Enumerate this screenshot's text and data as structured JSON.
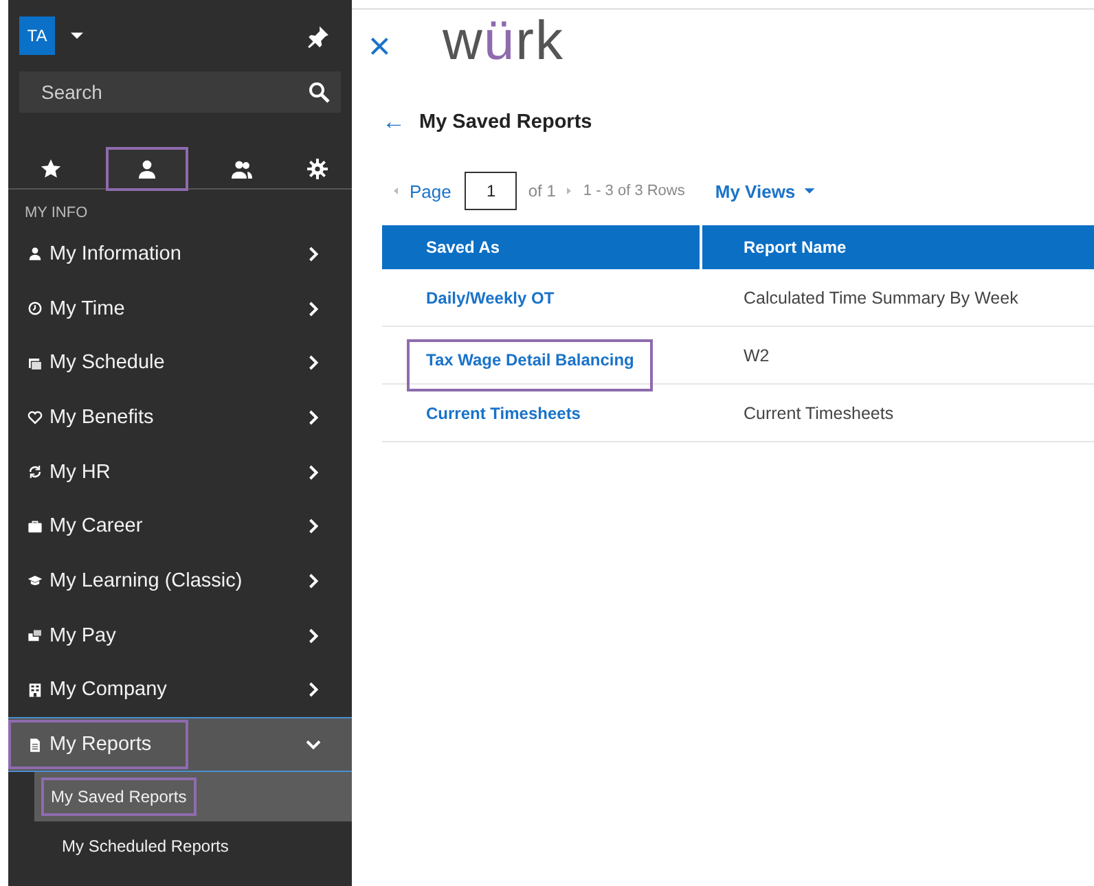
{
  "sidebar": {
    "avatar": "TA",
    "search": {
      "placeholder": "Search"
    },
    "tabs": [
      {
        "kind": "star",
        "selected": false
      },
      {
        "kind": "person",
        "selected": true
      },
      {
        "kind": "people",
        "selected": false
      },
      {
        "kind": "gear",
        "selected": false
      }
    ],
    "section_label": "MY INFO",
    "items": [
      {
        "kind": "person",
        "label": "My Information",
        "expanded": false,
        "highlighted": false
      },
      {
        "kind": "clock",
        "label": "My Time",
        "expanded": false,
        "highlighted": false
      },
      {
        "kind": "calendar",
        "label": "My Schedule",
        "expanded": false,
        "highlighted": false
      },
      {
        "kind": "heart",
        "label": "My Benefits",
        "expanded": false,
        "highlighted": false
      },
      {
        "kind": "arrows",
        "label": "My HR",
        "expanded": false,
        "highlighted": false
      },
      {
        "kind": "briefcase",
        "label": "My Career",
        "expanded": false,
        "highlighted": false
      },
      {
        "kind": "cap",
        "label": "My Learning (Classic)",
        "expanded": false,
        "highlighted": false
      },
      {
        "kind": "money",
        "label": "My Pay",
        "expanded": false,
        "highlighted": false
      },
      {
        "kind": "building",
        "label": "My Company",
        "expanded": false,
        "highlighted": false
      },
      {
        "kind": "document",
        "label": "My Reports",
        "expanded": true,
        "highlighted": true,
        "children": [
          {
            "label": "My Saved Reports",
            "selected": true,
            "highlighted": true
          },
          {
            "label": "My Scheduled Reports",
            "selected": false,
            "highlighted": false
          }
        ]
      }
    ]
  },
  "header": {
    "close": "×",
    "logo": [
      {
        "text": "w",
        "color": "#555555"
      },
      {
        "text": "ü",
        "color": "#8e6bad"
      },
      {
        "text": "rk",
        "color": "#555555"
      }
    ]
  },
  "page": {
    "back": "←",
    "title": "My Saved Reports",
    "pager": {
      "label": "Page",
      "value": "1",
      "of": "of 1",
      "range": "1 - 3 of 3 Rows",
      "views": "My Views"
    },
    "table": {
      "columns": [
        "Saved As",
        "Report Name"
      ],
      "rows": [
        {
          "saved_as": "Daily/Weekly OT",
          "report_name": "Calculated Time Summary By Week",
          "highlighted": false
        },
        {
          "saved_as": "Tax Wage Detail Balancing",
          "report_name": "W2",
          "highlighted": true
        },
        {
          "saved_as": "Current Timesheets",
          "report_name": "Current Timesheets",
          "highlighted": false
        }
      ]
    }
  }
}
